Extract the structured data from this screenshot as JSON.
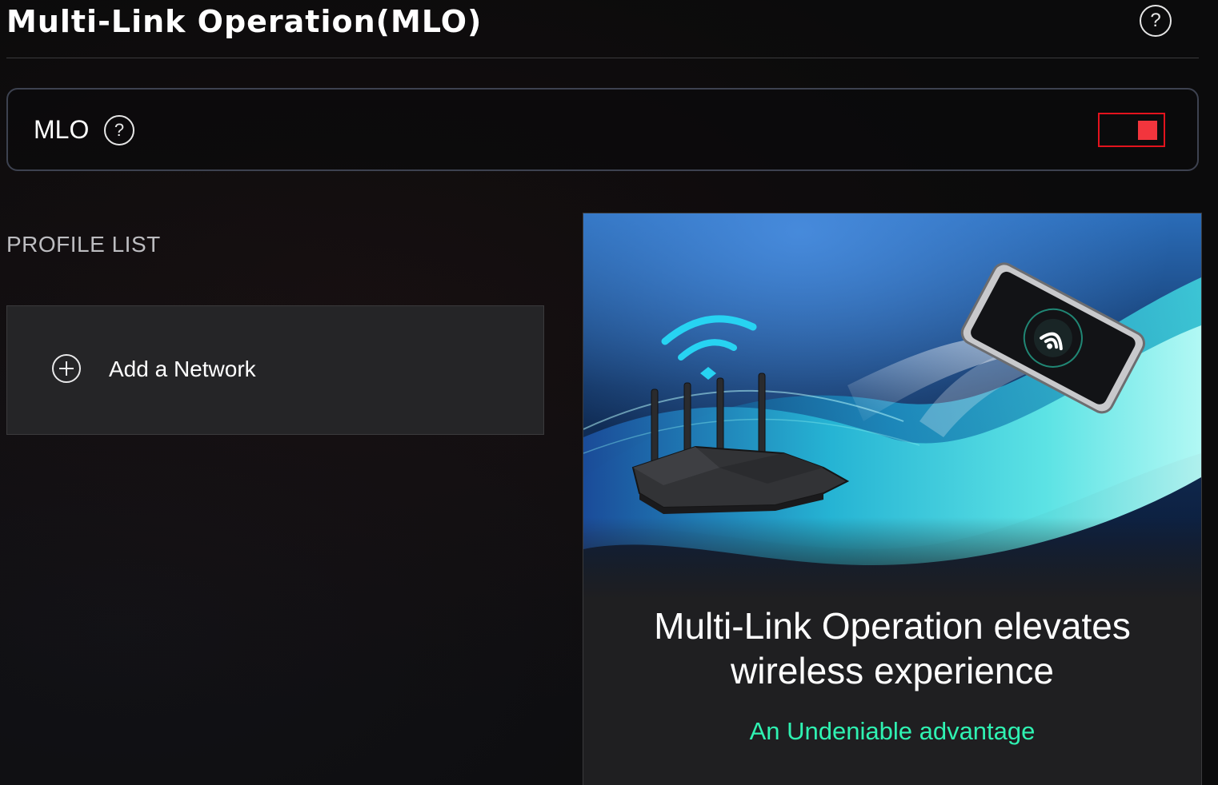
{
  "header": {
    "title": "Multi-Link Operation(MLO)",
    "help_icon": "question-circle-icon"
  },
  "mlo_setting": {
    "label": "MLO",
    "help_icon": "question-circle-icon",
    "toggle_state": "on",
    "toggle_color": "#e3131d"
  },
  "profile_list": {
    "heading": "PROFILE LIST",
    "add_network_label": "Add a Network",
    "add_icon": "plus-circle-icon"
  },
  "promo": {
    "image": "router-and-phone-wifi-illustration",
    "heading": "Multi-Link Operation elevates wireless experience",
    "subheading": "An Undeniable advantage",
    "subheading_color": "#2ff2b2"
  },
  "help_glyph": "?"
}
